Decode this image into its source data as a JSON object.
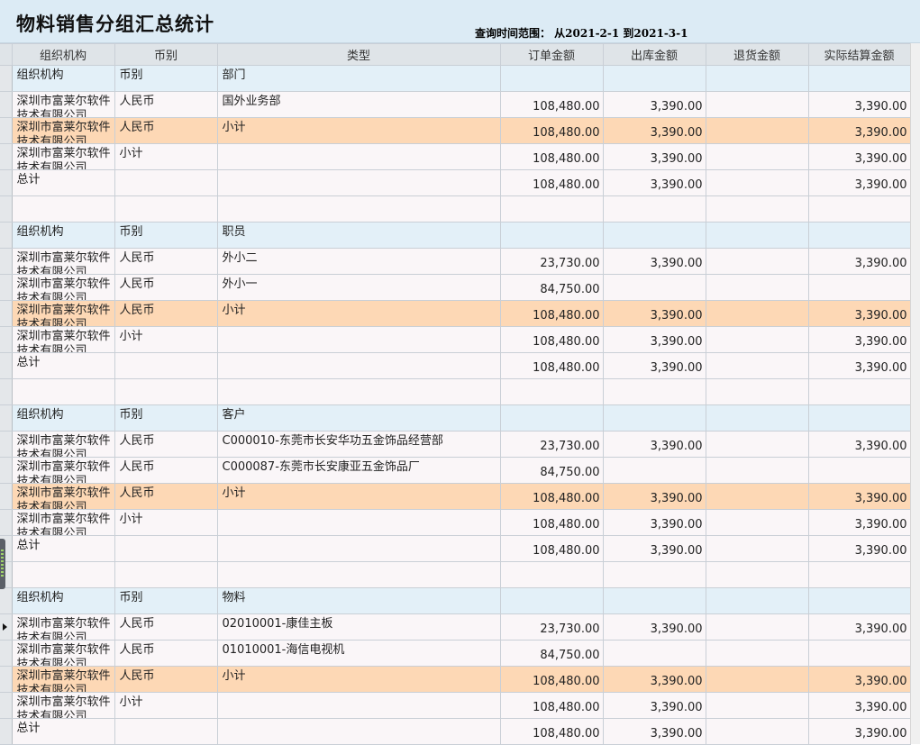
{
  "header": {
    "title": "物料销售分组汇总统计",
    "query_range": "查询时间范围： 从2021-2-1 到2021-3-1"
  },
  "columns": [
    "组织机构",
    "币别",
    "类型",
    "订单金额",
    "出库金额",
    "退货金额",
    "实际结算金额"
  ],
  "rows": [
    {
      "kind": "band-head",
      "cells": [
        "组织机构",
        "币别",
        "部门",
        "",
        "",
        "",
        ""
      ]
    },
    {
      "kind": "plain",
      "cells": [
        "深圳市富莱尔软件技术有限公司",
        "人民币",
        "国外业务部",
        "108,480.00",
        "3,390.00",
        "",
        "3,390.00"
      ]
    },
    {
      "kind": "sel",
      "cells": [
        "深圳市富莱尔软件技术有限公司",
        "人民币",
        "小计",
        "108,480.00",
        "3,390.00",
        "",
        "3,390.00"
      ]
    },
    {
      "kind": "plain",
      "cells": [
        "深圳市富莱尔软件技术有限公司",
        "小计",
        "",
        "108,480.00",
        "3,390.00",
        "",
        "3,390.00"
      ]
    },
    {
      "kind": "plain",
      "cells": [
        "总计",
        "",
        "",
        "108,480.00",
        "3,390.00",
        "",
        "3,390.00"
      ]
    },
    {
      "kind": "blank",
      "cells": [
        "",
        "",
        "",
        "",
        "",
        "",
        ""
      ]
    },
    {
      "kind": "band-head",
      "cells": [
        "组织机构",
        "币别",
        "职员",
        "",
        "",
        "",
        ""
      ]
    },
    {
      "kind": "plain",
      "cells": [
        "深圳市富莱尔软件技术有限公司",
        "人民币",
        "外小二",
        "23,730.00",
        "3,390.00",
        "",
        "3,390.00"
      ]
    },
    {
      "kind": "plain",
      "cells": [
        "深圳市富莱尔软件技术有限公司",
        "人民币",
        "外小一",
        "84,750.00",
        "",
        "",
        ""
      ]
    },
    {
      "kind": "sel",
      "cells": [
        "深圳市富莱尔软件技术有限公司",
        "人民币",
        "小计",
        "108,480.00",
        "3,390.00",
        "",
        "3,390.00"
      ]
    },
    {
      "kind": "plain",
      "cells": [
        "深圳市富莱尔软件技术有限公司",
        "小计",
        "",
        "108,480.00",
        "3,390.00",
        "",
        "3,390.00"
      ]
    },
    {
      "kind": "plain",
      "cells": [
        "总计",
        "",
        "",
        "108,480.00",
        "3,390.00",
        "",
        "3,390.00"
      ]
    },
    {
      "kind": "blank",
      "cells": [
        "",
        "",
        "",
        "",
        "",
        "",
        ""
      ]
    },
    {
      "kind": "band-head",
      "cells": [
        "组织机构",
        "币别",
        "客户",
        "",
        "",
        "",
        ""
      ]
    },
    {
      "kind": "plain",
      "cells": [
        "深圳市富莱尔软件技术有限公司",
        "人民币",
        "C000010-东莞市长安华功五金饰品经营部",
        "23,730.00",
        "3,390.00",
        "",
        "3,390.00"
      ]
    },
    {
      "kind": "plain",
      "cells": [
        "深圳市富莱尔软件技术有限公司",
        "人民币",
        "C000087-东莞市长安康亚五金饰品厂",
        "84,750.00",
        "",
        "",
        ""
      ]
    },
    {
      "kind": "sel",
      "cells": [
        "深圳市富莱尔软件技术有限公司",
        "人民币",
        "小计",
        "108,480.00",
        "3,390.00",
        "",
        "3,390.00"
      ]
    },
    {
      "kind": "plain",
      "cells": [
        "深圳市富莱尔软件技术有限公司",
        "小计",
        "",
        "108,480.00",
        "3,390.00",
        "",
        "3,390.00"
      ]
    },
    {
      "kind": "plain",
      "cells": [
        "总计",
        "",
        "",
        "108,480.00",
        "3,390.00",
        "",
        "3,390.00"
      ]
    },
    {
      "kind": "blank",
      "cells": [
        "",
        "",
        "",
        "",
        "",
        "",
        ""
      ]
    },
    {
      "kind": "band-head",
      "cells": [
        "组织机构",
        "币别",
        "物料",
        "",
        "",
        "",
        ""
      ]
    },
    {
      "kind": "plain",
      "current": true,
      "cells": [
        "深圳市富莱尔软件技术有限公司",
        "人民币",
        "02010001-康佳主板",
        "23,730.00",
        "3,390.00",
        "",
        "3,390.00"
      ]
    },
    {
      "kind": "plain",
      "cells": [
        "深圳市富莱尔软件技术有限公司",
        "人民币",
        "01010001-海信电视机",
        "84,750.00",
        "",
        "",
        ""
      ]
    },
    {
      "kind": "sel",
      "cells": [
        "深圳市富莱尔软件技术有限公司",
        "人民币",
        "小计",
        "108,480.00",
        "3,390.00",
        "",
        "3,390.00"
      ]
    },
    {
      "kind": "plain",
      "cells": [
        "深圳市富莱尔软件技术有限公司",
        "小计",
        "",
        "108,480.00",
        "3,390.00",
        "",
        "3,390.00"
      ]
    },
    {
      "kind": "plain",
      "cells": [
        "总计",
        "",
        "",
        "108,480.00",
        "3,390.00",
        "",
        "3,390.00"
      ]
    }
  ]
}
